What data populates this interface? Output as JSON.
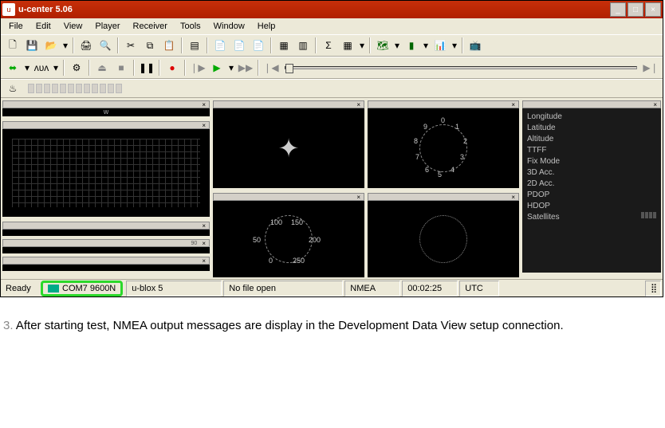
{
  "title": "u-center 5.06",
  "menu": [
    "File",
    "Edit",
    "View",
    "Player",
    "Receiver",
    "Tools",
    "Window",
    "Help"
  ],
  "status": {
    "ready": "Ready",
    "com": "COM7  9600N",
    "device": "u-blox 5",
    "file": "No file open",
    "proto": "NMEA",
    "time": "00:02:25",
    "tz": "UTC"
  },
  "info_labels": [
    "Longitude",
    "Latitude",
    "Altitude",
    "TTFF",
    "Fix Mode",
    "3D Acc.",
    "2D Acc.",
    "PDOP",
    "HDOP",
    "Satellites"
  ],
  "clock_dial": [
    "0",
    "1",
    "2",
    "3",
    "4",
    "5",
    "6",
    "7",
    "8",
    "9"
  ],
  "speedo": {
    "ticks": [
      "0",
      "50",
      "100",
      "150",
      "200",
      "250"
    ]
  },
  "caption_num": "3.",
  "caption_text": "After starting test, NMEA output messages are display in the Development Data View setup connection."
}
